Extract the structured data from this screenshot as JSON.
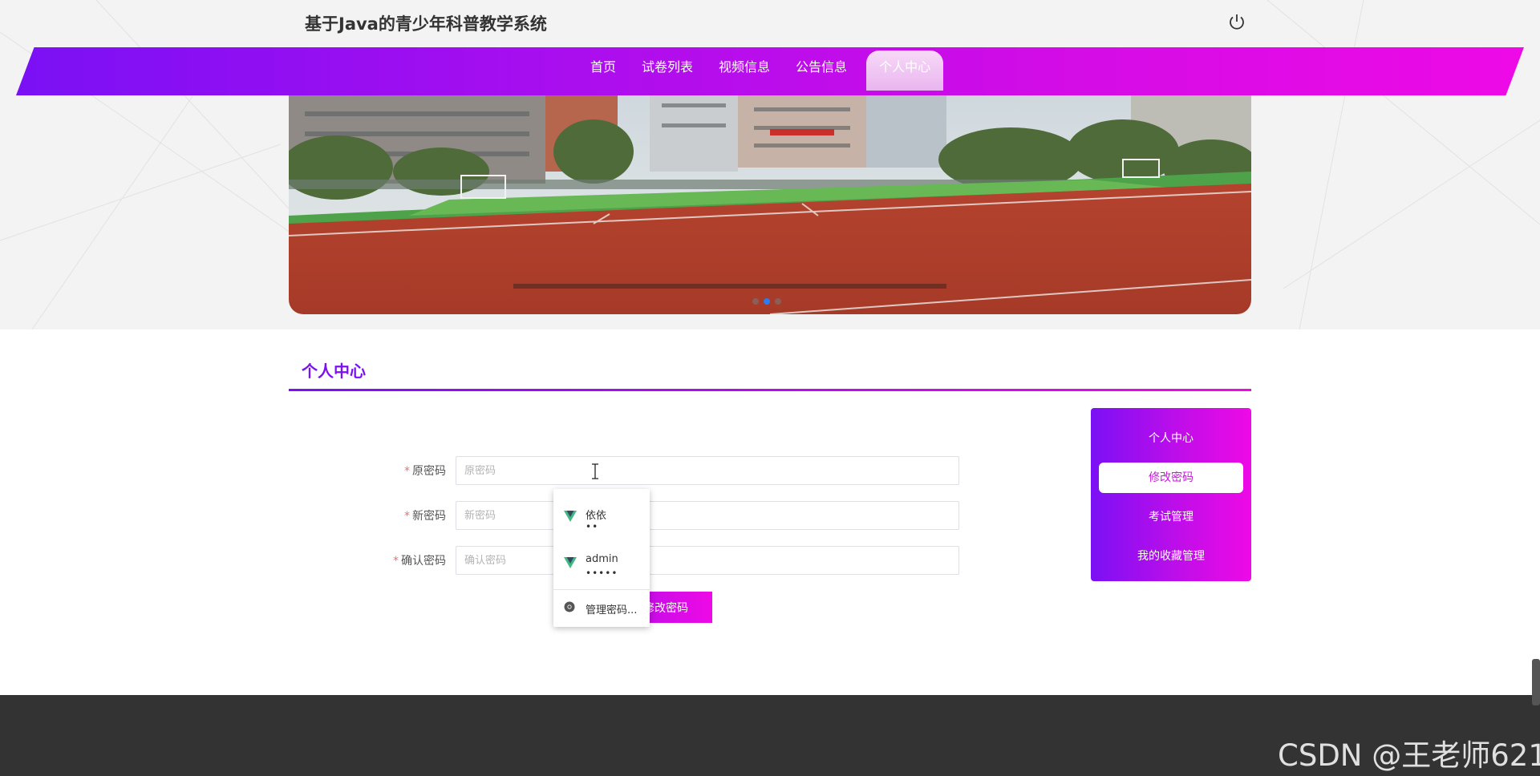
{
  "header": {
    "site_title": "基于Java的青少年科普教学系统",
    "power_icon": "power-icon"
  },
  "nav": {
    "items": [
      {
        "label": "首页"
      },
      {
        "label": "试卷列表"
      },
      {
        "label": "视频信息"
      },
      {
        "label": "公告信息"
      },
      {
        "label": "个人中心",
        "active": true
      }
    ]
  },
  "banner": {
    "dots": 3,
    "active_dot": 2
  },
  "section": {
    "title": "个人中心"
  },
  "form": {
    "old_password": {
      "label": "原密码",
      "placeholder": "原密码",
      "required": "*"
    },
    "new_password": {
      "label": "新密码",
      "placeholder": "新密码",
      "required": "*"
    },
    "confirm_password": {
      "label": "确认密码",
      "placeholder": "确认密码",
      "required": "*"
    },
    "submit_label": "修改密码"
  },
  "autofill": {
    "entries": [
      {
        "name": "依依",
        "password_mask": "••"
      },
      {
        "name": "admin",
        "password_mask": "•••••"
      }
    ],
    "manage_label": "管理密码..."
  },
  "side_menu": {
    "items": [
      {
        "label": "个人中心"
      },
      {
        "label": "修改密码",
        "active": true
      },
      {
        "label": "考试管理"
      },
      {
        "label": "我的收藏管理"
      }
    ]
  },
  "watermark": "CSDN @王老师621",
  "colors": {
    "brand_start": "#7b10f5",
    "brand_end": "#ee0ae6",
    "footer": "#333333"
  }
}
